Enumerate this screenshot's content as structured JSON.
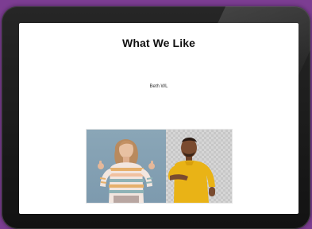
{
  "slide": {
    "title": "What We Like",
    "author": "Beth WL"
  },
  "images": {
    "left": {
      "subject": "woman in striped sweater giving thumbs-up"
    },
    "right": {
      "subject": "man in yellow t-shirt pointing forward"
    }
  },
  "colors": {
    "background": "#7c3d92",
    "tablet_frame": "#1f1f1f",
    "screen": "#ffffff",
    "title_text": "#111111"
  }
}
